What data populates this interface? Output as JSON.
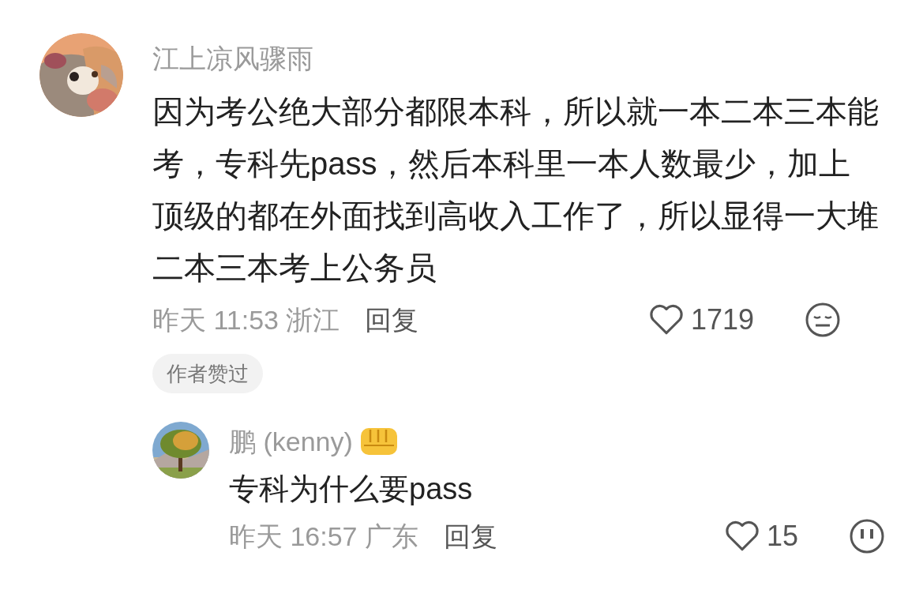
{
  "comment": {
    "author": "江上凉风骤雨",
    "text": "因为考公绝大部分都限本科，所以就一本二本三本能考，专科先pass，然后本科里一本人数最少，加上顶级的都在外面找到高收入工作了，所以显得一大堆二本三本考上公务员",
    "date": "昨天",
    "time": "11:53",
    "location": "浙江",
    "reply_label": "回复",
    "likes": "1719",
    "liked": false,
    "badge": "作者赞过"
  },
  "reply": {
    "author": "鹏 (kenny)",
    "text": "专科为什么要pass",
    "date": "昨天",
    "time": "16:57",
    "location": "广东",
    "reply_label": "回复",
    "likes": "15",
    "liked": false
  }
}
